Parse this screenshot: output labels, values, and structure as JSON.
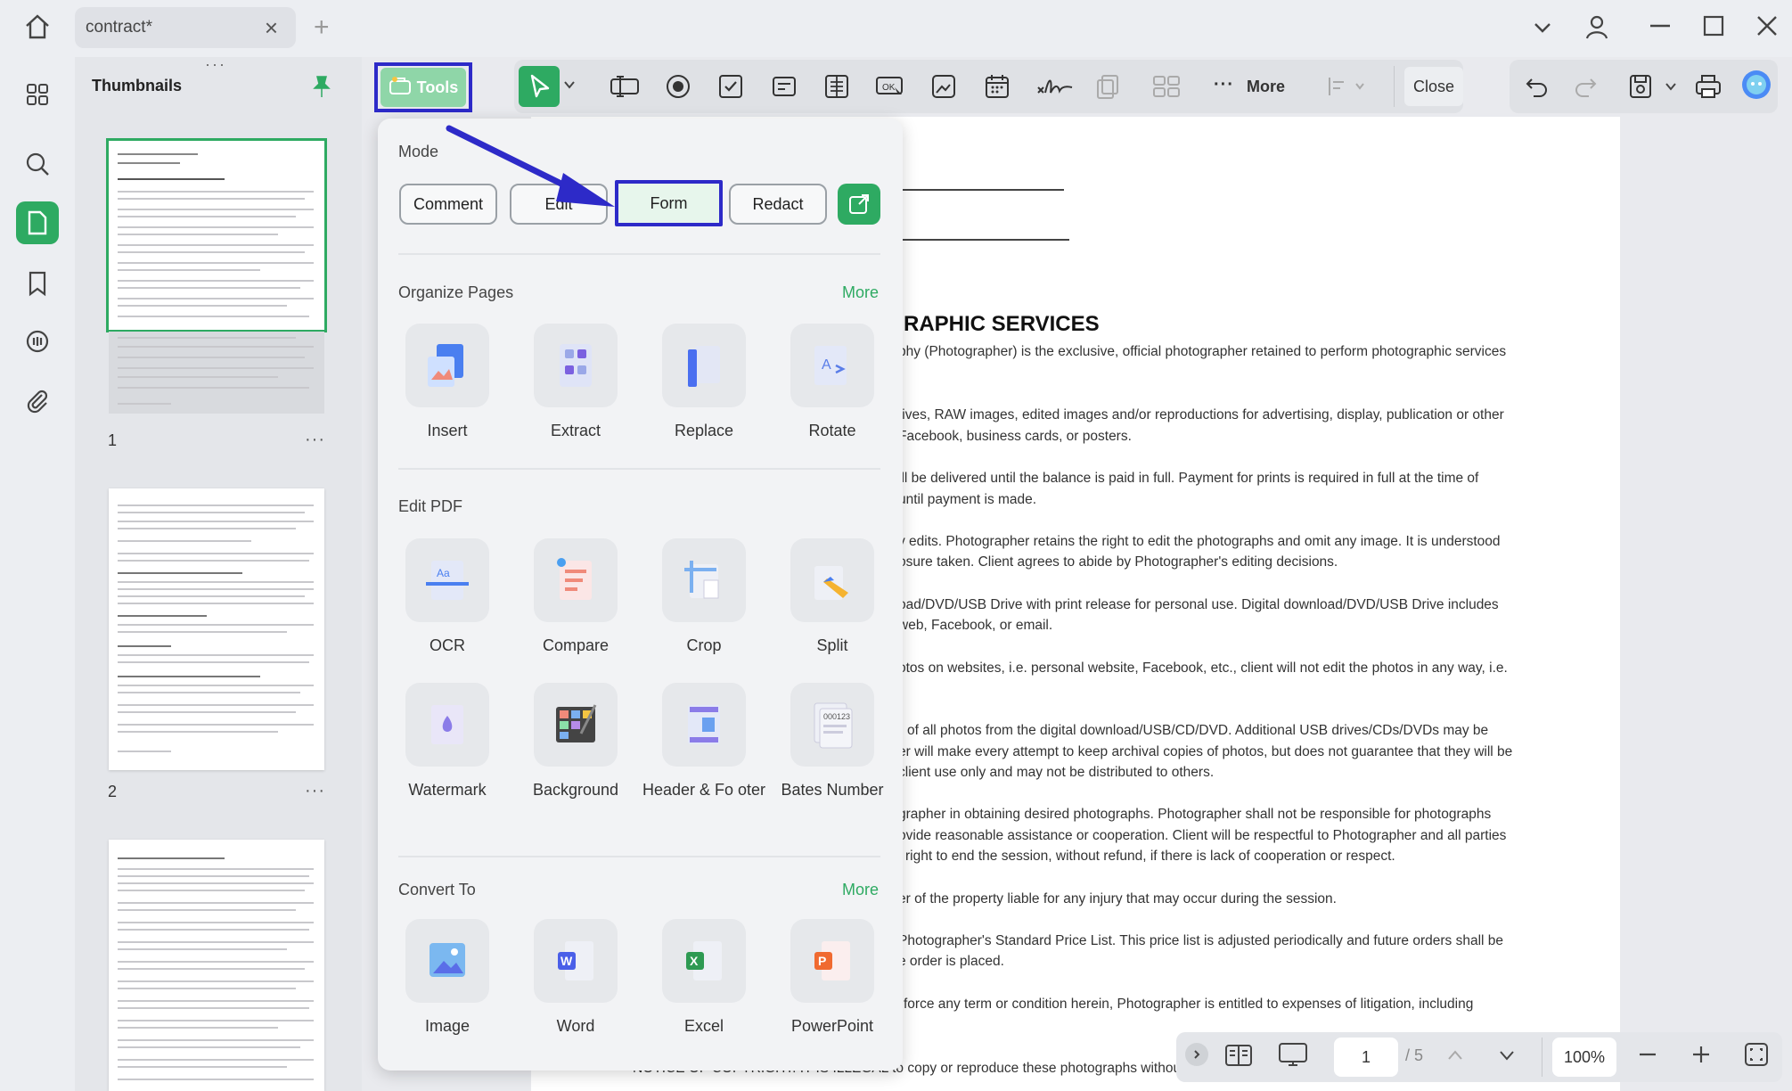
{
  "tab": {
    "title": "contract*"
  },
  "thumbnails": {
    "title": "Thumbnails",
    "pages": [
      {
        "num": "1"
      },
      {
        "num": "2"
      }
    ],
    "more_label": "···"
  },
  "toolbar": {
    "tools_label": "Tools",
    "more_label": "More",
    "close_label": "Close"
  },
  "popup": {
    "mode_title": "Mode",
    "modes": [
      "Comment",
      "Edit",
      "Form",
      "Redact"
    ],
    "organize": {
      "title": "Organize Pages",
      "more": "More",
      "items": [
        "Insert",
        "Extract",
        "Replace",
        "Rotate"
      ]
    },
    "edit": {
      "title": "Edit PDF",
      "items": [
        "OCR",
        "Compare",
        "Crop",
        "Split",
        "Watermark",
        "Background",
        "Header & Fo oter",
        "Bates Number"
      ]
    },
    "convert": {
      "title": "Convert To",
      "more": "More",
      "items": [
        "Image",
        "Word",
        "Excel",
        "PowerPoint"
      ]
    }
  },
  "document": {
    "heading": "RAPHIC SERVICES",
    "lines": [
      "phy (Photographer) is the exclusive, official photographer retained to perform photographic services",
      "tives, RAW images, edited images and/or reproductions for advertising, display, publication or other",
      "Facebook, business cards, or posters.",
      "ill be delivered until the balance is paid in full. Payment for prints is required in full at the time of",
      "until payment is made.",
      "y edits. Photographer retains the right to edit the photographs and omit any image. It is understood",
      "osure taken. Client agrees to abide by Photographer's editing decisions.",
      "oad/DVD/USB Drive with print release for personal use. Digital download/DVD/USB Drive includes",
      "web, Facebook, or email.",
      "otos on websites, i.e. personal website, Facebook, etc., client will not edit the photos in any way, i.e.",
      "of all photos from the digital download/USB/CD/DVD. Additional USB drives/CDs/DVDs may be",
      "er will make every attempt to keep archival copies of photos, but does not guarantee that they will be",
      "client use only and may not be distributed to others.",
      "grapher in obtaining desired photographs. Photographer shall not be responsible for photographs",
      "ovide reasonable assistance or cooperation. Client will be respectful to Photographer and all parties",
      "right to end the session, without refund, if there is lack of cooperation or respect.",
      "er of the property liable for any injury that may occur during the session.",
      "Photographer's Standard Price List. This price list is adjusted periodically and future orders shall be",
      "e order is placed.",
      "force any term or condition herein, Photographer is entitled to expenses of litigation, including",
      "NOTICE OF COPYRIGHT: IT IS ILLEGAL to copy or reproduce these photographs without"
    ]
  },
  "bottom": {
    "page_current": "1",
    "page_total": "/ 5",
    "zoom": "100%"
  },
  "colors": {
    "accent": "#2eaa62",
    "highlight": "#2d2ac8"
  }
}
